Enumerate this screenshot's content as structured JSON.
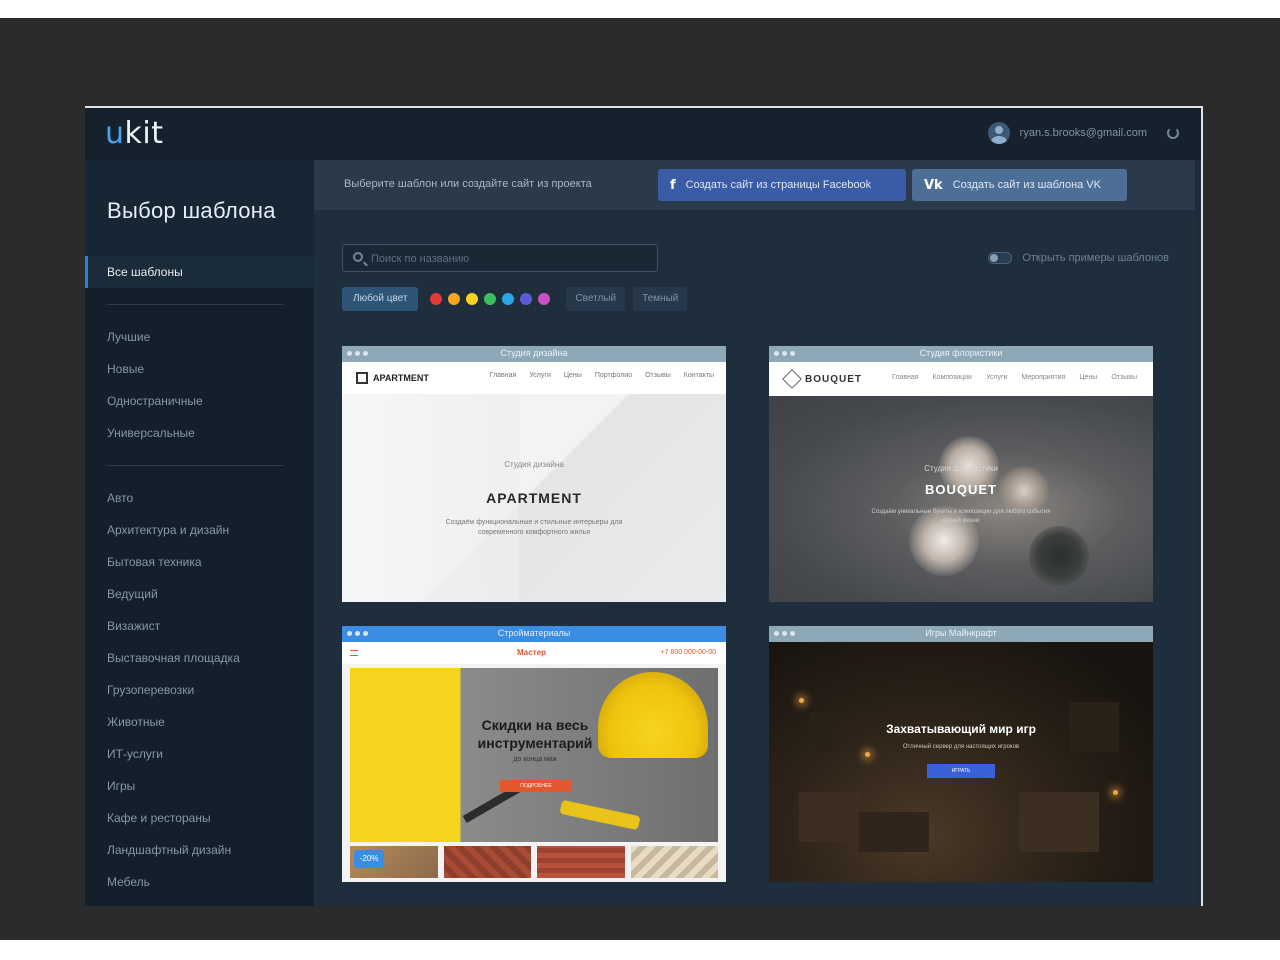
{
  "header": {
    "logo_prefix": "u",
    "logo_rest": "kit",
    "user_email": "ryan.s.brooks@gmail.com"
  },
  "sidebar": {
    "title": "Выбор шаблона",
    "active_item": "Все шаблоны",
    "group_a": [
      "Лучшие",
      "Новые",
      "Одностраничные",
      "Универсальные"
    ],
    "group_b": [
      "Авто",
      "Архитектура и дизайн",
      "Бытовая техника",
      "Ведущий",
      "Визажист",
      "Выставочная площадка",
      "Грузоперевозки",
      "Животные",
      "ИТ-услуги",
      "Игры",
      "Кафе и рестораны",
      "Ландшафтный дизайн",
      "Мебель"
    ]
  },
  "actionbar": {
    "hint": "Выберите шаблон или создайте сайт из проекта",
    "facebook_label": "Создать сайт из страницы Facebook",
    "facebook_icon": "f",
    "vk_label": "Создать сайт из шаблона VK",
    "vk_icon": "Vk"
  },
  "filters": {
    "search_placeholder": "Поиск по названию",
    "toggle_label": "Открыть примеры шаблонов",
    "any_color_label": "Любой цвет",
    "color_swatches": [
      "#e53935",
      "#f5a623",
      "#f5d31f",
      "#3bbf5e",
      "#2ba6e8",
      "#5b5bd6",
      "#c94fc3"
    ],
    "light_label": "Светлый",
    "dark_label": "Темный"
  },
  "templates": [
    {
      "bar_title": "Студия дизайна",
      "nav_logo": "APARTMENT",
      "nav_menu": [
        "Главная",
        "Услуги",
        "Цены",
        "Портфолио",
        "Отзывы",
        "Контакты"
      ],
      "subtitle": "Студия дизайна",
      "title": "APARTMENT",
      "description": "Создаём функциональные и стильные интерьеры для современного комфортного жилья"
    },
    {
      "bar_title": "Студия флористики",
      "nav_logo": "BOUQUET",
      "nav_menu": [
        "Главная",
        "Композиции",
        "Услуги",
        "Мероприятия",
        "Цены",
        "Отзывы"
      ],
      "subtitle": "Студия флористики",
      "title": "BOUQUET",
      "description": "Создаём уникальные букеты и композиции для любого события вашей жизни"
    },
    {
      "bar_title": "Стройматериалы",
      "nav_logo": "Мастер",
      "nav_phone": "+7 800 000-00-00",
      "title": "Скидки на весь инструментарий",
      "subtitle": "до конца мая",
      "button_label": "ПОДРОБНЕЕ",
      "badge": "-20%"
    },
    {
      "bar_title": "Игры Майнкрафт",
      "title": "Захватывающий мир игр",
      "subtitle": "Отличный сервер для настоящих игроков",
      "button_label": "ИГРАТЬ"
    }
  ]
}
